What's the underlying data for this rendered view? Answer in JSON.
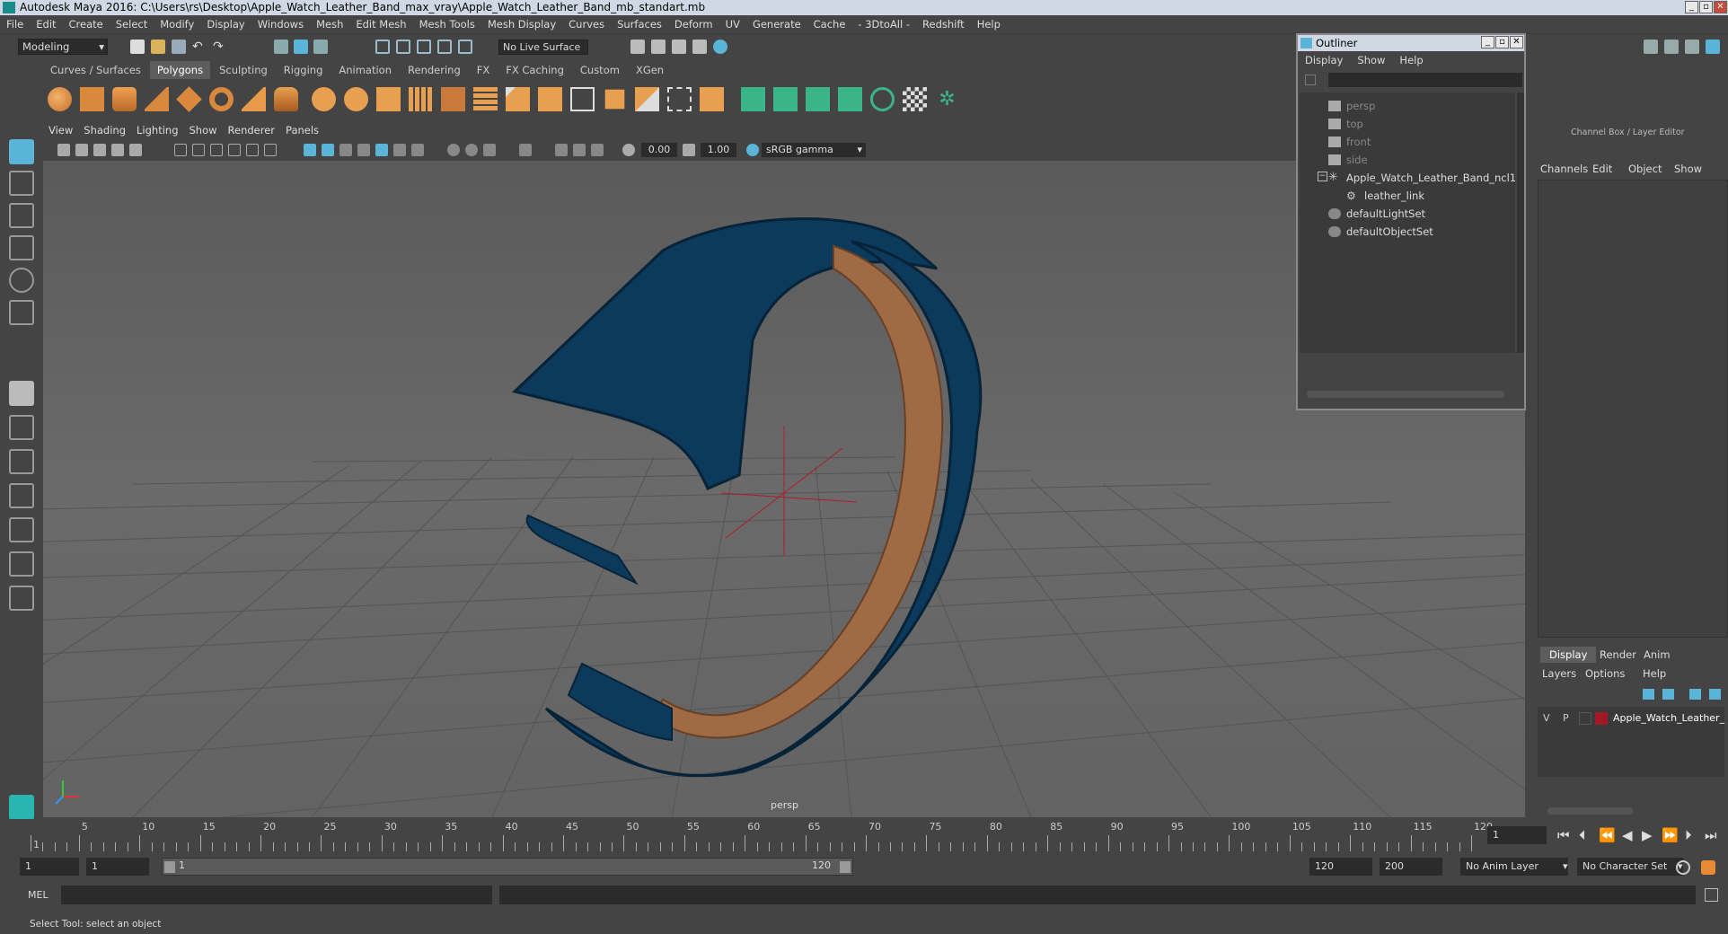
{
  "window": {
    "title": "Autodesk Maya 2016: C:\\Users\\rs\\Desktop\\Apple_Watch_Leather_Band_max_vray\\Apple_Watch_Leather_Band_mb_standart.mb"
  },
  "menubar": [
    "File",
    "Edit",
    "Create",
    "Select",
    "Modify",
    "Display",
    "Windows",
    "Mesh",
    "Edit Mesh",
    "Mesh Tools",
    "Mesh Display",
    "Curves",
    "Surfaces",
    "Deform",
    "UV",
    "Generate",
    "Cache",
    "- 3DtoAll -",
    "Redshift",
    "Help"
  ],
  "status": {
    "mode": "Modeling",
    "live_surface": "No Live Surface"
  },
  "shelf_tabs": [
    "Curves / Surfaces",
    "Polygons",
    "Sculpting",
    "Rigging",
    "Animation",
    "Rendering",
    "FX",
    "FX Caching",
    "Custom",
    "XGen"
  ],
  "viewport": {
    "menu": [
      "View",
      "Shading",
      "Lighting",
      "Show",
      "Renderer",
      "Panels"
    ],
    "exposure": "0.00",
    "gamma": "1.00",
    "color_space": "sRGB gamma",
    "camera_label": "persp"
  },
  "outliner": {
    "title": "Outliner",
    "menu": [
      "Display",
      "Show",
      "Help"
    ],
    "items": [
      "persp",
      "top",
      "front",
      "side",
      "Apple_Watch_Leather_Band_ncl1",
      "leather_link",
      "defaultLightSet",
      "defaultObjectSet"
    ]
  },
  "channel_box": {
    "title": "Channel Box / Layer Editor",
    "menu": [
      "Channels",
      "Edit",
      "Object",
      "Show"
    ],
    "layer_tabs": [
      "Display",
      "Render",
      "Anim"
    ],
    "layer_menu": [
      "Layers",
      "Options",
      "Help"
    ],
    "layer": {
      "v": "V",
      "p": "P",
      "name": "Apple_Watch_Leather_",
      "color": "#a0182a"
    }
  },
  "timeline": {
    "ticks": [
      "1",
      "5",
      "10",
      "15",
      "20",
      "25",
      "30",
      "35",
      "40",
      "45",
      "50",
      "55",
      "60",
      "65",
      "70",
      "75",
      "80",
      "85",
      "90",
      "95",
      "100",
      "105",
      "110",
      "115",
      "120"
    ],
    "current_frame": "1"
  },
  "range": {
    "start": "1",
    "inner_start": "1",
    "slider_start": "1",
    "slider_end": "120",
    "end": "120",
    "max": "200",
    "anim_layer": "No Anim Layer",
    "char_set": "No Character Set"
  },
  "cmdline": {
    "label": "MEL"
  },
  "helpline": {
    "text": "Select Tool: select an object"
  },
  "colors": {
    "band_outer": "#0c3a5c",
    "band_inner": "#a06a44",
    "accent": "#5ab4d8"
  }
}
